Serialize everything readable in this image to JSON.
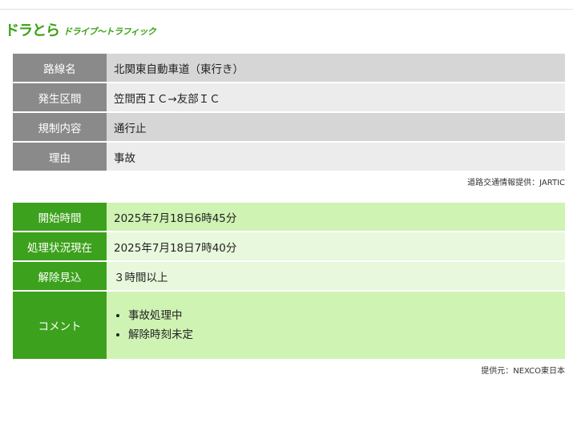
{
  "logo": {
    "main": "ドラとら",
    "sub": "ドライブ〜トラフィック"
  },
  "info_rows": [
    {
      "label": "路線名",
      "value": "北関東自動車道（東行き）"
    },
    {
      "label": "発生区間",
      "value": "笠間西ＩＣ→友部ＩＣ"
    },
    {
      "label": "規制内容",
      "value": "通行止"
    },
    {
      "label": "理由",
      "value": "事故"
    }
  ],
  "info_credit": "道路交通情報提供：JARTIC",
  "time_rows": [
    {
      "label": "開始時間",
      "value": "2025年7月18日6時45分"
    },
    {
      "label": "処理状況現在",
      "value": "2025年7月18日7時40分"
    },
    {
      "label": "解除見込",
      "value": "３時間以上"
    }
  ],
  "comment": {
    "label": "コメント",
    "items": [
      "事故処理中",
      "解除時刻未定"
    ]
  },
  "time_credit": "提供元：NEXCO東日本",
  "colors": {
    "brand_green": "#3aa117",
    "label_gray": "#8a8a8a",
    "row_green": "#cff3b3"
  }
}
